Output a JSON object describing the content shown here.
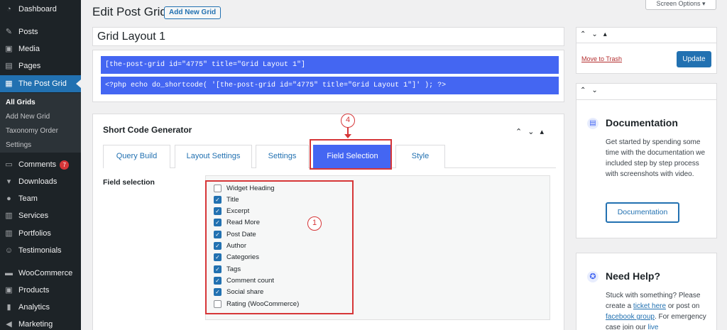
{
  "sidebar": {
    "items": [
      {
        "label": "Dashboard",
        "icon": "dashboard-icon"
      },
      {
        "label": "Posts",
        "icon": "pin-icon"
      },
      {
        "label": "Media",
        "icon": "media-icon"
      },
      {
        "label": "Pages",
        "icon": "page-icon"
      },
      {
        "label": "The Post Grid",
        "icon": "grid-icon"
      },
      {
        "label": "Comments",
        "icon": "comment-icon",
        "badge": "7"
      },
      {
        "label": "Downloads",
        "icon": "download-icon"
      },
      {
        "label": "Team",
        "icon": "team-icon"
      },
      {
        "label": "Services",
        "icon": "services-icon"
      },
      {
        "label": "Portfolios",
        "icon": "portfolio-icon"
      },
      {
        "label": "Testimonials",
        "icon": "testimonial-icon"
      },
      {
        "label": "WooCommerce",
        "icon": "woo-icon"
      },
      {
        "label": "Products",
        "icon": "products-icon"
      },
      {
        "label": "Analytics",
        "icon": "analytics-icon"
      },
      {
        "label": "Marketing",
        "icon": "marketing-icon"
      }
    ],
    "submenu": [
      "All Grids",
      "Add New Grid",
      "Taxonomy Order",
      "Settings"
    ]
  },
  "header": {
    "title": "Edit Post Grid",
    "add_new": "Add New Grid",
    "screen_options": "Screen Options ▾"
  },
  "grid_title": "Grid Layout 1",
  "shortcodes": [
    "[the-post-grid id=\"4775\" title=\"Grid Layout 1\"]",
    "<?php echo do_shortcode( '[the-post-grid id=\"4775\" title=\"Grid Layout 1\"]' ); ?>"
  ],
  "generator": {
    "title": "Short Code Generator",
    "tabs": [
      "Query Build",
      "Layout Settings",
      "Settings",
      "Field Selection",
      "Style"
    ],
    "active_tab": "Field Selection",
    "field_label": "Field selection",
    "fields": [
      {
        "label": "Widget Heading",
        "checked": false
      },
      {
        "label": "Title",
        "checked": true
      },
      {
        "label": "Excerpt",
        "checked": true
      },
      {
        "label": "Read More",
        "checked": true
      },
      {
        "label": "Post Date",
        "checked": true
      },
      {
        "label": "Author",
        "checked": true
      },
      {
        "label": "Categories",
        "checked": true
      },
      {
        "label": "Tags",
        "checked": true
      },
      {
        "label": "Comment count",
        "checked": true
      },
      {
        "label": "Social share",
        "checked": true
      },
      {
        "label": "Rating (WooCommerce)",
        "checked": false
      }
    ]
  },
  "annotations": {
    "step_tab": "4",
    "step_fields": "1"
  },
  "publish": {
    "trash": "Move to Trash",
    "update": "Update"
  },
  "documentation": {
    "title": "Documentation",
    "text": "Get started by spending some time with the documentation we included step by step process with screenshots with video.",
    "button": "Documentation"
  },
  "help": {
    "title": "Need Help?",
    "text_1": "Stuck with something? Please create a ",
    "link_1": "ticket here",
    "text_2": " or post on ",
    "link_2": "facebook group",
    "text_3": ". For emergency case join our ",
    "link_3": "live"
  },
  "colors": {
    "accent": "#4466f2",
    "wp_blue": "#2271b1",
    "annotation": "#d63638"
  }
}
